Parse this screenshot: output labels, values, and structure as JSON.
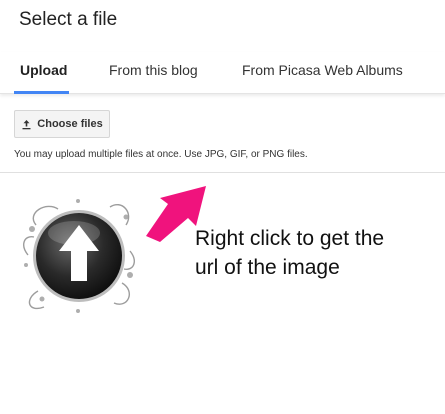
{
  "dialog": {
    "title": "Select a file"
  },
  "tabs": [
    {
      "label": "Upload",
      "active": true
    },
    {
      "label": "From this blog",
      "active": false
    },
    {
      "label": "From Picasa Web Albums",
      "active": false
    }
  ],
  "upload": {
    "choose_files_label": "Choose files",
    "note": "You may upload multiple files at once. Use JPG, GIF, or PNG files."
  },
  "annotation": {
    "line1": "Right click to get the",
    "line2": "url of the image",
    "arrow_color": "#f0137d"
  },
  "colors": {
    "accent": "#4285f4"
  }
}
